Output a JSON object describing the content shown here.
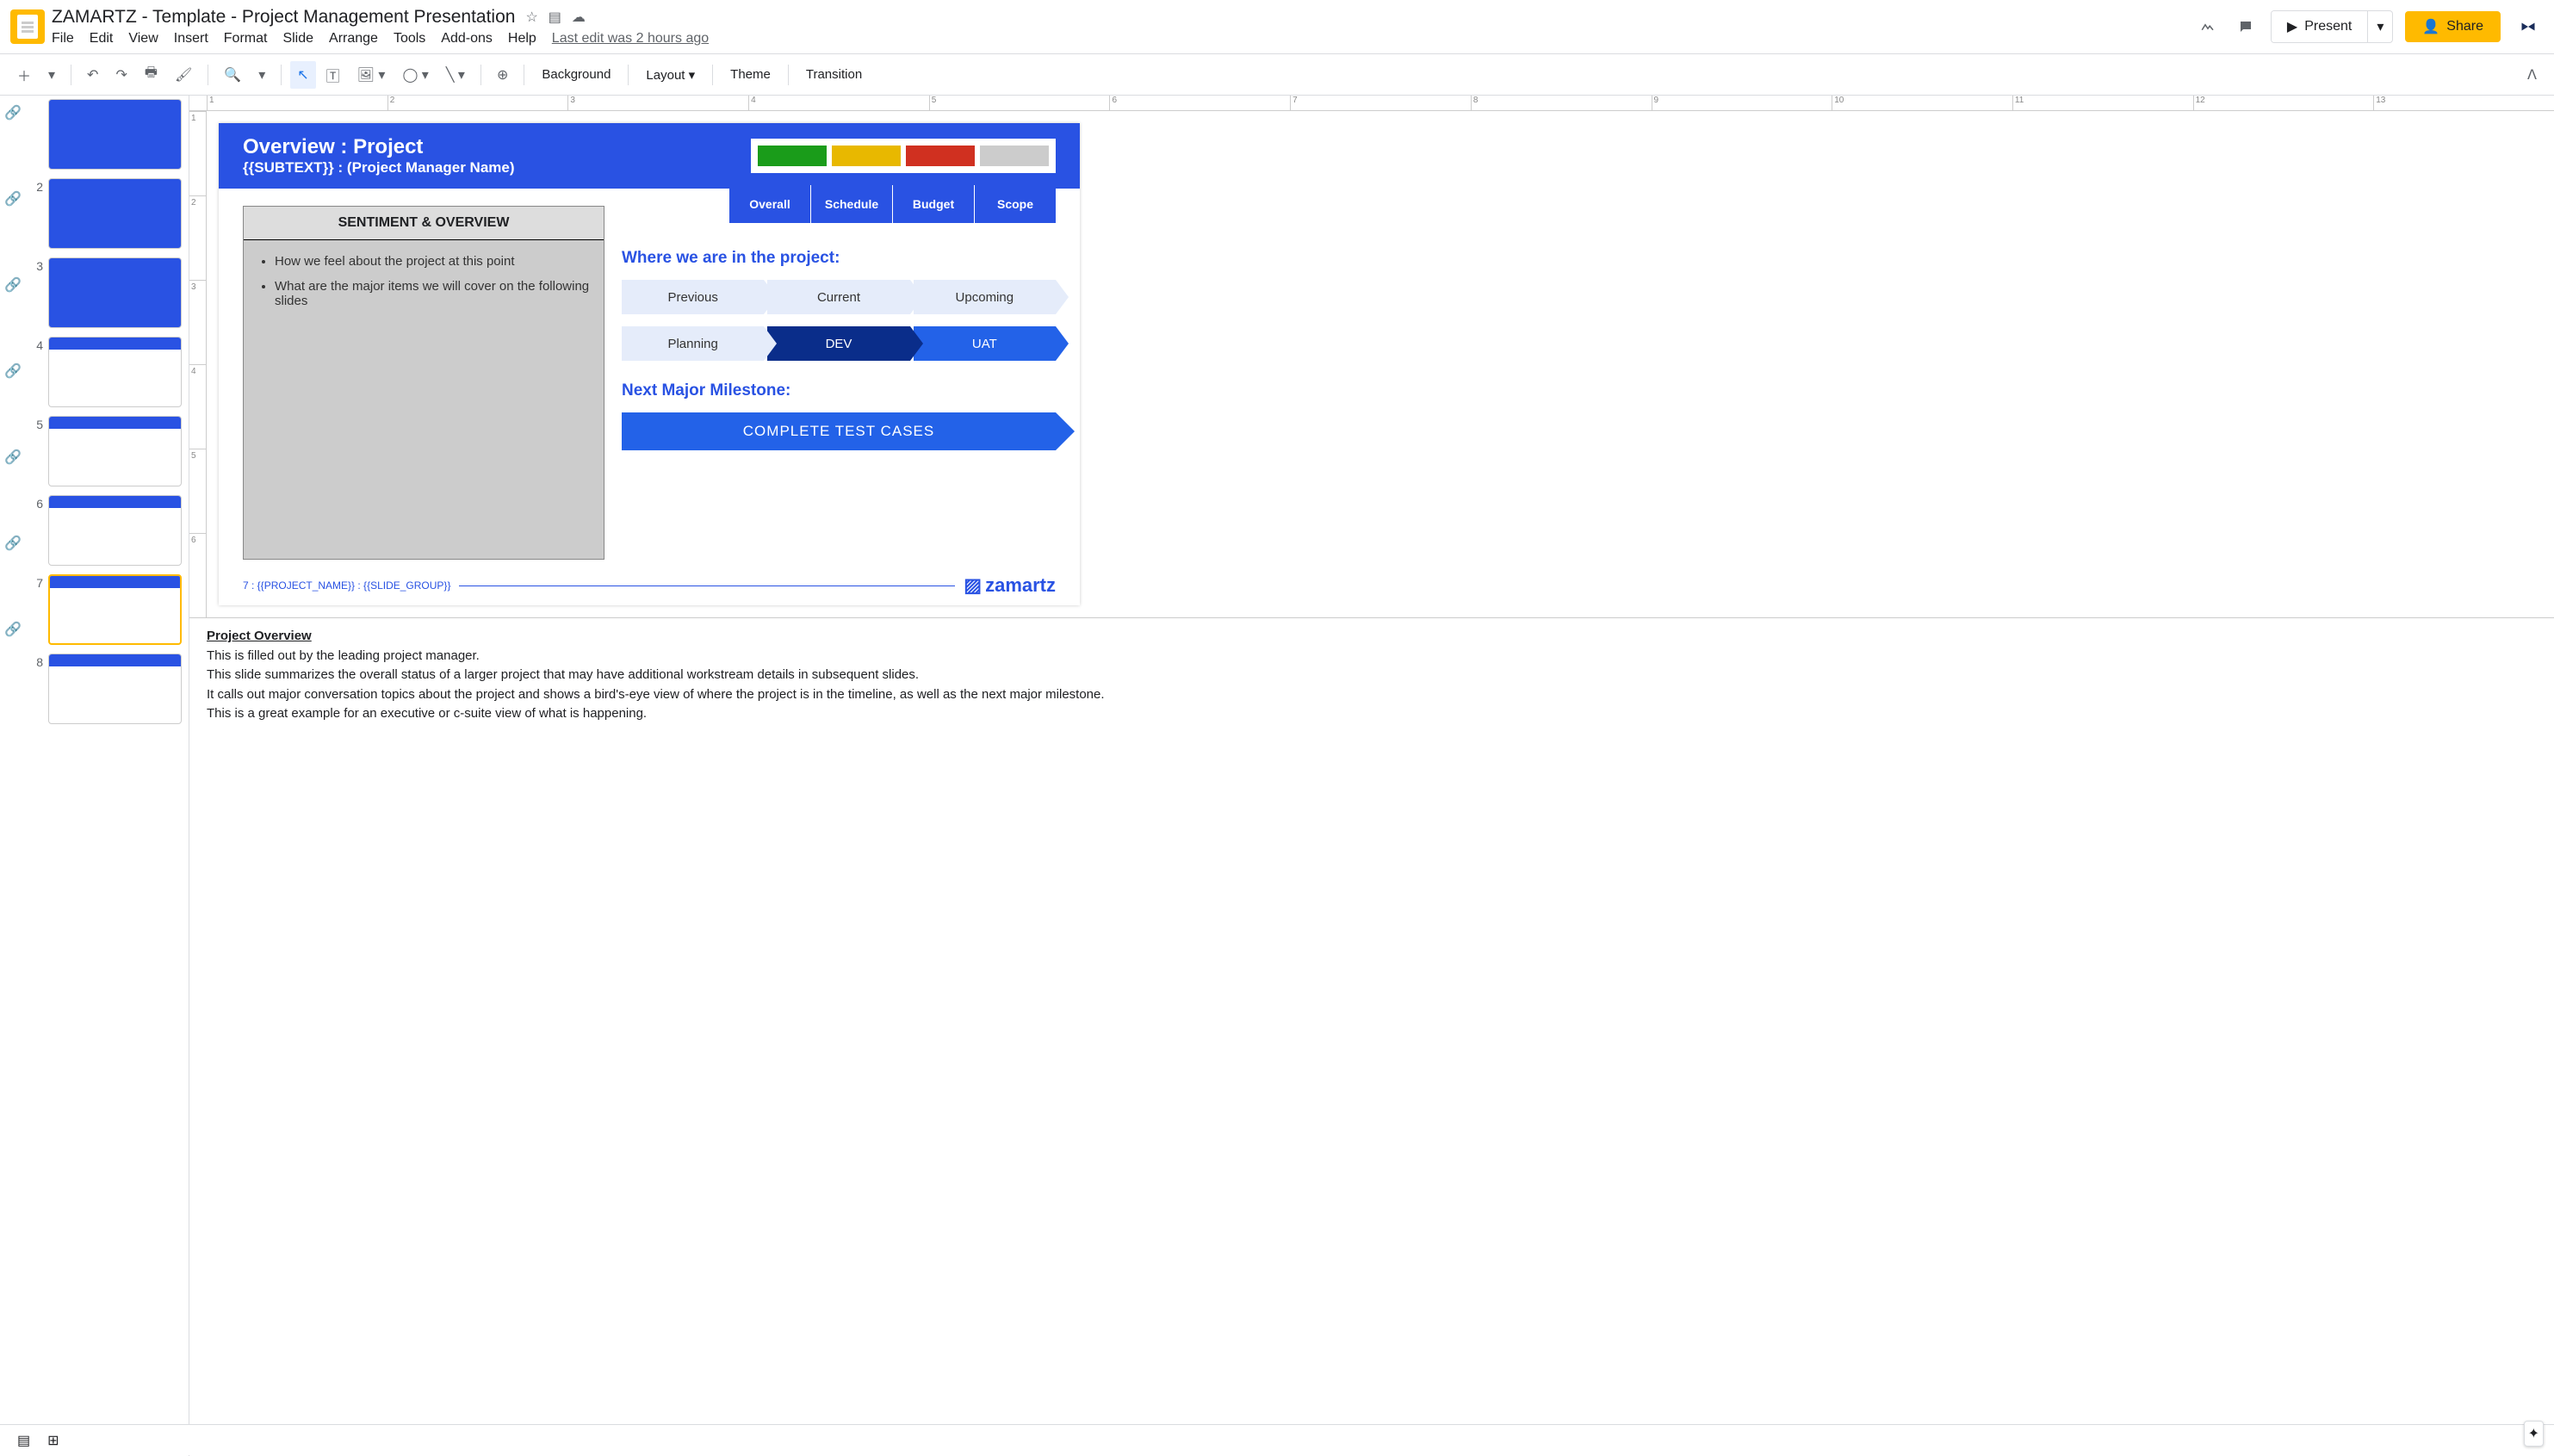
{
  "header": {
    "doc_title": "ZAMARTZ - Template - Project Management Presentation",
    "menu": [
      "File",
      "Edit",
      "View",
      "Insert",
      "Format",
      "Slide",
      "Arrange",
      "Tools",
      "Add-ons",
      "Help"
    ],
    "last_edit": "Last edit was 2 hours ago",
    "present_label": "Present",
    "share_label": "Share"
  },
  "toolbar": {
    "background": "Background",
    "layout": "Layout",
    "theme": "Theme",
    "transition": "Transition"
  },
  "ruler_h": [
    "1",
    "2",
    "3",
    "4",
    "5",
    "6",
    "7",
    "8",
    "9",
    "10",
    "11",
    "12",
    "13"
  ],
  "ruler_v": [
    "1",
    "2",
    "3",
    "4",
    "5",
    "6"
  ],
  "thumbnails": [
    {
      "num": "",
      "type": "blue"
    },
    {
      "num": "2",
      "type": "blue"
    },
    {
      "num": "3",
      "type": "blue"
    },
    {
      "num": "4",
      "type": "split"
    },
    {
      "num": "5",
      "type": "white"
    },
    {
      "num": "6",
      "type": "white"
    },
    {
      "num": "7",
      "type": "white",
      "selected": true
    },
    {
      "num": "8",
      "type": "white"
    }
  ],
  "slide": {
    "title": "Overview : Project",
    "subtext": "{{SUBTEXT}} : (Project Manager Name)",
    "status_labels": [
      "Overall",
      "Schedule",
      "Budget",
      "Scope"
    ],
    "sentiment_header": "SENTIMENT & OVERVIEW",
    "sentiment_bullets": [
      "How we feel about the project at this point",
      "What are the major items we will cover on the following slides"
    ],
    "where_header": "Where we are in the project:",
    "phases_top": [
      "Previous",
      "Current",
      "Upcoming"
    ],
    "phases_bottom": [
      "Planning",
      "DEV",
      "UAT"
    ],
    "milestone_header": "Next Major Milestone:",
    "milestone_label": "COMPLETE TEST CASES",
    "footer": "7 : {{PROJECT_NAME}} : {{SLIDE_GROUP}}",
    "brand": "zamartz"
  },
  "notes": {
    "title": "Project Overview",
    "lines": [
      "This is filled out by the leading project manager.",
      "This slide summarizes the overall status of a larger project that may have additional workstream details in subsequent slides.",
      "It calls out major conversation topics about the project and shows a bird's-eye view of where the project is in the timeline, as well as the next major milestone.",
      "This is a great example for an executive or c-suite view of what is happening."
    ]
  }
}
